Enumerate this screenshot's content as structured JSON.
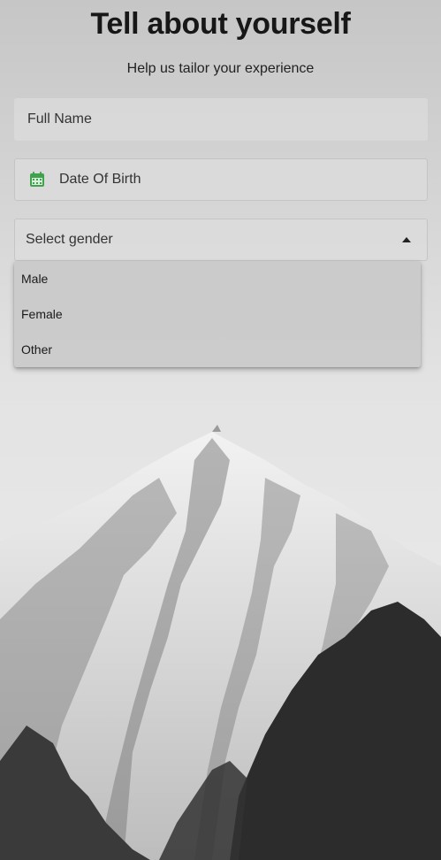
{
  "header": {
    "title": "Tell about yourself",
    "subtitle": "Help us tailor your experience"
  },
  "form": {
    "full_name": {
      "placeholder": "Full Name"
    },
    "date_of_birth": {
      "placeholder": "Date Of Birth",
      "icon": "calendar-icon",
      "icon_color": "#3fa34d"
    },
    "gender": {
      "placeholder": "Select gender",
      "icon": "caret-up-icon",
      "options": [
        "Male",
        "Female",
        "Other"
      ]
    }
  },
  "background": {
    "image": "snowy-mountain-photo"
  }
}
